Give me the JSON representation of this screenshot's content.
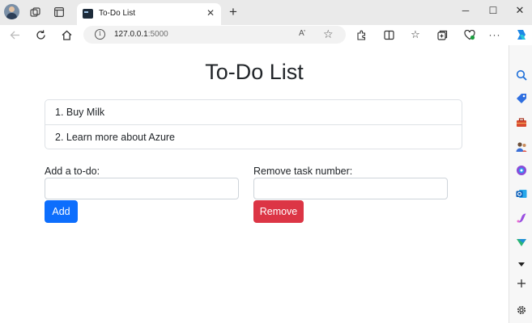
{
  "browser": {
    "tab_title": "To-Do List",
    "tab_close": "✕",
    "new_tab": "+",
    "address": "127.0.0.1",
    "address_port": ":5000",
    "read_aloud": "A’",
    "window_min": "─",
    "window_max": "☐",
    "window_close": "✕"
  },
  "page": {
    "title": "To-Do List",
    "tasks": [
      "1. Buy Milk",
      "2. Learn more about Azure"
    ],
    "add_label": "Add a to-do:",
    "add_value": "",
    "add_button": "Add",
    "remove_label": "Remove task number:",
    "remove_value": "",
    "remove_button": "Remove"
  },
  "colors": {
    "primary": "#0d6efd",
    "danger": "#dc3545",
    "text": "#212529"
  },
  "icons": {
    "sidebar": [
      "search-icon",
      "shopping-tag-icon",
      "toolbox-icon",
      "people-icon",
      "copilot-m365-icon",
      "outlook-icon",
      "designer-icon",
      "drop-icon",
      "chevron-down-icon",
      "add-icon",
      "settings-icon"
    ]
  }
}
